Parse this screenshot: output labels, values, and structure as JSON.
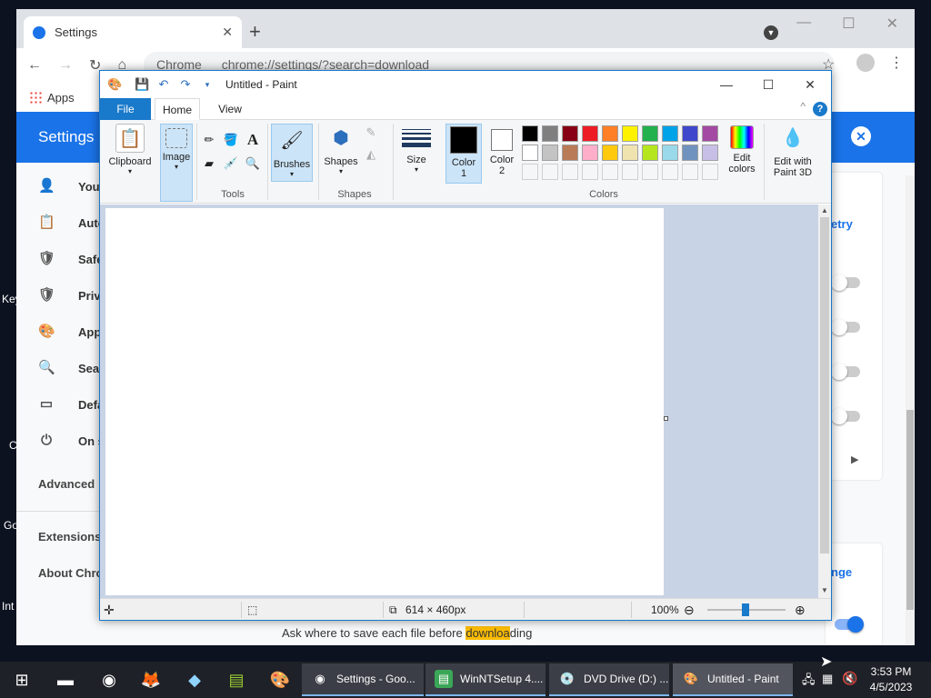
{
  "desktop": {
    "labels": [
      "Key",
      "C",
      "Go",
      "Int"
    ]
  },
  "chrome": {
    "tab_title": "Settings",
    "url": "chrome://settings/?search=download",
    "url_prefix": "Chrome",
    "bookmark_apps": "Apps",
    "header_title": "Settings",
    "sidebar": [
      {
        "label": "You",
        "icon": "person-icon"
      },
      {
        "label": "Auto",
        "icon": "clipboard-icon"
      },
      {
        "label": "Safe",
        "icon": "shield-check-icon"
      },
      {
        "label": "Priv",
        "icon": "shield-icon"
      },
      {
        "label": "App",
        "icon": "palette-icon"
      },
      {
        "label": "Sear",
        "icon": "search-icon"
      },
      {
        "label": "Defa",
        "icon": "browser-icon"
      },
      {
        "label": "On s",
        "icon": "power-icon"
      }
    ],
    "advanced": "Advanced",
    "extensions": "Extensions",
    "about": "About Chro",
    "retry_btn": "etry",
    "change_btn": "nge",
    "ask_text_before": "Ask where to save each file before ",
    "ask_text_mark": "downloa",
    "ask_text_after": "ding"
  },
  "paint": {
    "title": "Untitled - Paint",
    "tabs": {
      "file": "File",
      "home": "Home",
      "view": "View"
    },
    "help": "?",
    "groups": {
      "clipboard": "Clipboard",
      "image": "Image",
      "tools": "Tools",
      "brushes": "Brushes",
      "shapes_btn": "Shapes",
      "shapes": "Shapes",
      "size": "Size",
      "color1": "Color\n1",
      "color1_a": "Color",
      "color1_b": "1",
      "color2_a": "Color",
      "color2_b": "2",
      "colors": "Colors",
      "edit_colors_a": "Edit",
      "edit_colors_b": "colors",
      "paint3d_a": "Edit with",
      "paint3d_b": "Paint 3D"
    },
    "palette_row1": [
      "#000000",
      "#7f7f7f",
      "#880015",
      "#ed1c24",
      "#ff7f27",
      "#fff200",
      "#22b14c",
      "#00a2e8",
      "#3f48cc",
      "#a349a4"
    ],
    "palette_row2": [
      "#ffffff",
      "#c3c3c3",
      "#b97a57",
      "#ffaec9",
      "#ffc90e",
      "#efe4b0",
      "#b5e61d",
      "#99d9ea",
      "#7092be",
      "#c8bfe7"
    ],
    "color1": "#000000",
    "color2": "#ffffff",
    "status": {
      "dimensions": "614 × 460px",
      "zoom": "100%"
    }
  },
  "taskbar": {
    "tasks": [
      {
        "label": "Settings - Goo...",
        "icon": "chrome-icon"
      },
      {
        "label": "WinNTSetup 4....",
        "icon": "winntsetup-icon"
      },
      {
        "label": "DVD Drive (D:) ...",
        "icon": "dvd-drive-icon"
      },
      {
        "label": "Untitled - Paint",
        "icon": "paint-icon"
      }
    ],
    "time": "3:53 PM",
    "date": "4/5/2023"
  }
}
